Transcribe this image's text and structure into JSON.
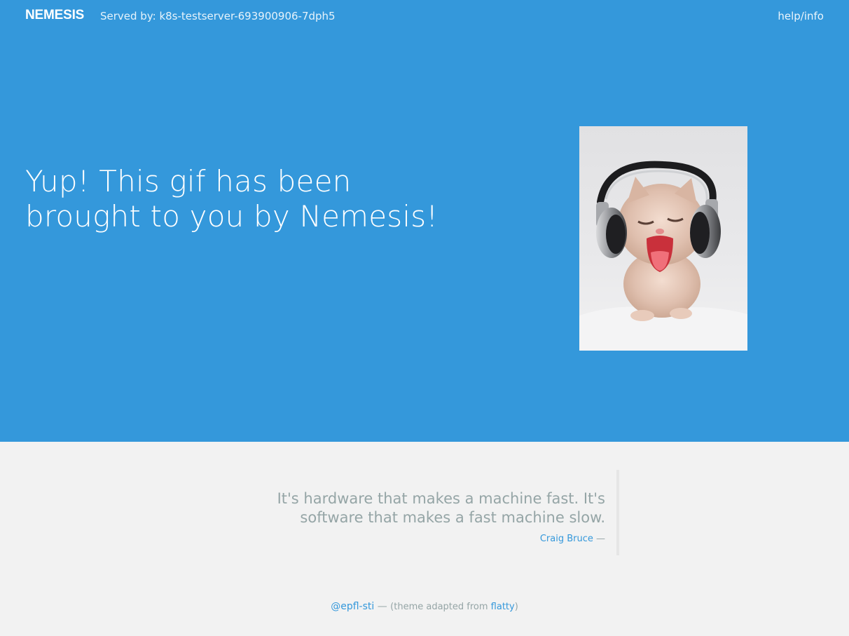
{
  "nav": {
    "brand": "NEMESIS",
    "served_by": "Served by: k8s-testserver-693900906-7dph5",
    "help_link": "help/info"
  },
  "hero": {
    "headline": "Yup! This gif has been brought to you by Nemesis!",
    "image": "kitten-with-headphones-gif"
  },
  "quote": {
    "text": "It's hardware that makes a machine fast. It's software that makes a fast machine slow.",
    "author": "Craig Bruce",
    "dash": "—"
  },
  "footer": {
    "handle": "@epfl-sti",
    "dash": "—",
    "theme_prefix": "(theme adapted from ",
    "theme_link": "flatty",
    "theme_suffix": ")"
  },
  "colors": {
    "hero_bg": "#3498db",
    "page_bg": "#f2f2f2",
    "muted_text": "#95a5a6",
    "link": "#3498db"
  }
}
